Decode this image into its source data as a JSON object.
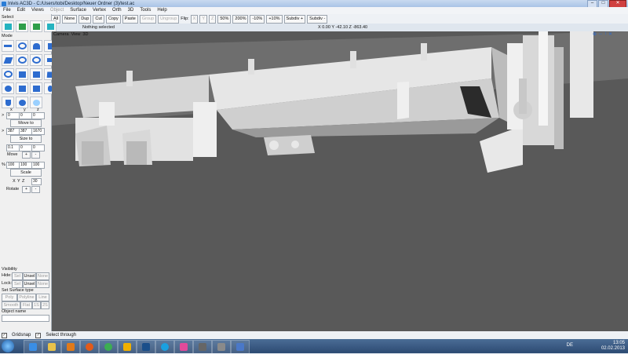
{
  "window": {
    "title": "Inivis AC3D - C:/Users/tobi/Desktop/Neuer Ordner (3)/test.ac",
    "minimize": "–",
    "maximize": "□",
    "close": "✕"
  },
  "menu": [
    "File",
    "Edit",
    "Views",
    "Object",
    "Surface",
    "Vertex",
    "Orth",
    "3D",
    "Tools",
    "Help"
  ],
  "toolbar": {
    "buttons": [
      "All",
      "None",
      "Dup",
      "Cut",
      "Copy",
      "Paste",
      "Group",
      "Ungroup"
    ],
    "flip_label": "Flip:",
    "flip_axes": [
      "X",
      "Y",
      "Z"
    ],
    "zoom": [
      "50%",
      "200%",
      "-10%",
      "+10%"
    ],
    "subdiv_plus": "Subdiv +",
    "subdiv_minus": "Subdiv -",
    "status": "Nothing selected",
    "coords": "X 0.00 Y -42.10 Z -863.40"
  },
  "left": {
    "select_label": "Select",
    "mode_label": "Mode",
    "xyz_labels": [
      "x",
      "y",
      "z"
    ],
    "move_values": [
      "0",
      "0",
      "0"
    ],
    "move_to": "Move to",
    "size_values": [
      "387",
      "387",
      "1670"
    ],
    "size_to": "Size to",
    "nudge_values": [
      "0.1",
      "0",
      "0"
    ],
    "move_label": "Move",
    "scale_values": [
      "100",
      "100",
      "100"
    ],
    "scale_label": "Scale",
    "rotate_axes": [
      "X",
      "Y",
      "Z"
    ],
    "rotate_value": "30",
    "rotate_label": "Rotate",
    "plus": "+",
    "minus": "-",
    "gt": ">",
    "pct": "%",
    "visibility_label": "Visibility",
    "hide_label": "Hide:",
    "lock_label": "Lock:",
    "vis_buttons": [
      "Sel",
      "Unsel",
      "None"
    ],
    "surface_label": "Set Surface type",
    "surface_buttons": [
      "Poly",
      "Polyline",
      "Line",
      "Smooth",
      "Flat",
      "1S",
      "2S"
    ],
    "object_name_label": "Object name",
    "palette_label": "1"
  },
  "viewport": {
    "menu": [
      "Camera",
      "View",
      "3D"
    ],
    "tools": [
      "⊕",
      "↔",
      "↕",
      "✕"
    ]
  },
  "bottom": {
    "gridsnap": "Gridsnap",
    "select_through": "Select through"
  },
  "taskbar": {
    "lang": "DE",
    "time": "13:05",
    "date": "02.02.2013"
  }
}
